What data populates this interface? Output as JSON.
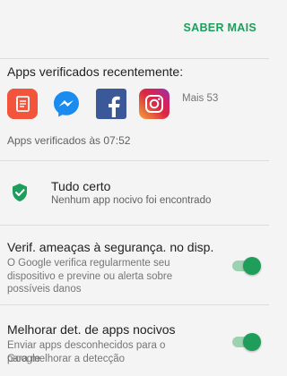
{
  "header": {
    "learn_more_label": "SABER MAIS"
  },
  "recent_apps": {
    "title": "Apps verificados recentemente:",
    "apps": [
      {
        "name": "notes-app-icon",
        "color": "#f2553c"
      },
      {
        "name": "messenger-icon",
        "color": "#1a8cf0"
      },
      {
        "name": "facebook-icon",
        "color": "#3b5998"
      },
      {
        "name": "instagram-icon",
        "color": "#c13584"
      }
    ],
    "more_label": "Mais 53",
    "checked_time": "Apps verificados às 07:52"
  },
  "status": {
    "title": "Tudo certo",
    "subtitle": "Nenhum app nocivo foi encontrado",
    "color": "#1e9e5a"
  },
  "settings": [
    {
      "title": "Verif. ameaças à segurança. no disp.",
      "description_lines": [
        "O Google verifica regularmente seu",
        "dispositivo e previne ou alerta sobre",
        "possíveis danos"
      ],
      "enabled": true
    },
    {
      "title": "Melhorar det. de apps nocivos",
      "description_lines": [
        "Enviar apps desconhecidos para o Google",
        "para melhorar a detecção"
      ],
      "enabled": true
    }
  ],
  "accent_color": "#1e9e5a"
}
